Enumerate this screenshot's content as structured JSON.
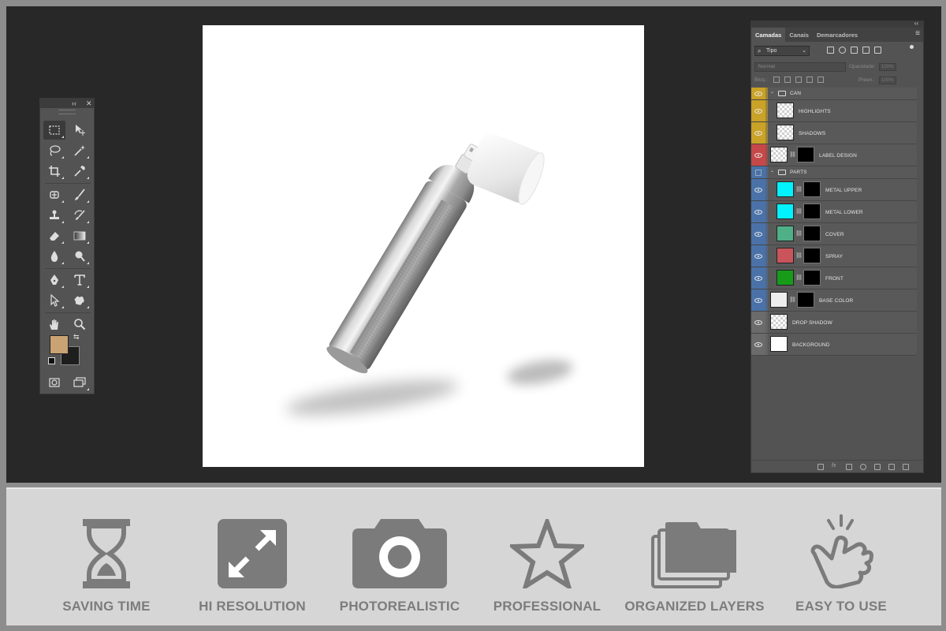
{
  "tools_panel": {
    "collapse_label": "‹‹",
    "close_label": "✕",
    "fg_color": "#c9a373",
    "bg_color": "#1e1e1e"
  },
  "layers_panel": {
    "tabs": [
      {
        "label": "Camadas",
        "active": true
      },
      {
        "label": "Canais",
        "active": false
      },
      {
        "label": "Demarcadores",
        "active": false
      }
    ],
    "kind_filter": "Tipo",
    "blend_mode": "Normal",
    "opacity_label": "Opacidade:",
    "opacity_value": "100%",
    "lock_label": "Bloq.:",
    "fill_label": "Preen.:",
    "fill_value": "100%",
    "layers": [
      {
        "name": "CAN",
        "type": "group",
        "label_color": "#c9a227",
        "indent": 0
      },
      {
        "name": "HIGHLIGHTS",
        "type": "layer",
        "label_color": "#c9a227",
        "indent": 1
      },
      {
        "name": "SHADOWS",
        "type": "layer",
        "label_color": "#c9a227",
        "indent": 1
      },
      {
        "name": "LABEL DESIGN",
        "type": "smart",
        "label_color": "#c64848",
        "indent": 0
      },
      {
        "name": "PARTS",
        "type": "group",
        "label_color": "#4a72a8",
        "indent": 0
      },
      {
        "name": "METAL UPPER",
        "type": "fill",
        "label_color": "#4a72a8",
        "indent": 1,
        "swatch": "#00f2ff"
      },
      {
        "name": "METAL LOWER",
        "type": "fill",
        "label_color": "#4a72a8",
        "indent": 1,
        "swatch": "#00f2ff"
      },
      {
        "name": "COVER",
        "type": "fill",
        "label_color": "#4a72a8",
        "indent": 1,
        "swatch": "#4fb087"
      },
      {
        "name": "SPRAY",
        "type": "fill",
        "label_color": "#4a72a8",
        "indent": 1,
        "swatch": "#c9545b"
      },
      {
        "name": "FRONT",
        "type": "fill",
        "label_color": "#4a72a8",
        "indent": 1,
        "swatch": "#179c1a"
      },
      {
        "name": "BASE COLOR",
        "type": "fill",
        "label_color": "#4a72a8",
        "indent": 0,
        "swatch": "#eeeeee"
      },
      {
        "name": "DROP SHADOW",
        "type": "layer",
        "label_color": "#6b6b6b",
        "indent": 0
      },
      {
        "name": "BACKGROUND",
        "type": "plain",
        "label_color": "#6b6b6b",
        "indent": 0
      }
    ]
  },
  "features": [
    {
      "label": "SAVING TIME",
      "icon": "hourglass-icon"
    },
    {
      "label": "HI RESOLUTION",
      "icon": "expand-icon"
    },
    {
      "label": "PHOTOREALISTIC",
      "icon": "camera-icon"
    },
    {
      "label": "PROFESSIONAL",
      "icon": "star-icon"
    },
    {
      "label": "ORGANIZED LAYERS",
      "icon": "stacked-folders-icon"
    },
    {
      "label": "EASY TO USE",
      "icon": "tap-hand-icon"
    }
  ]
}
